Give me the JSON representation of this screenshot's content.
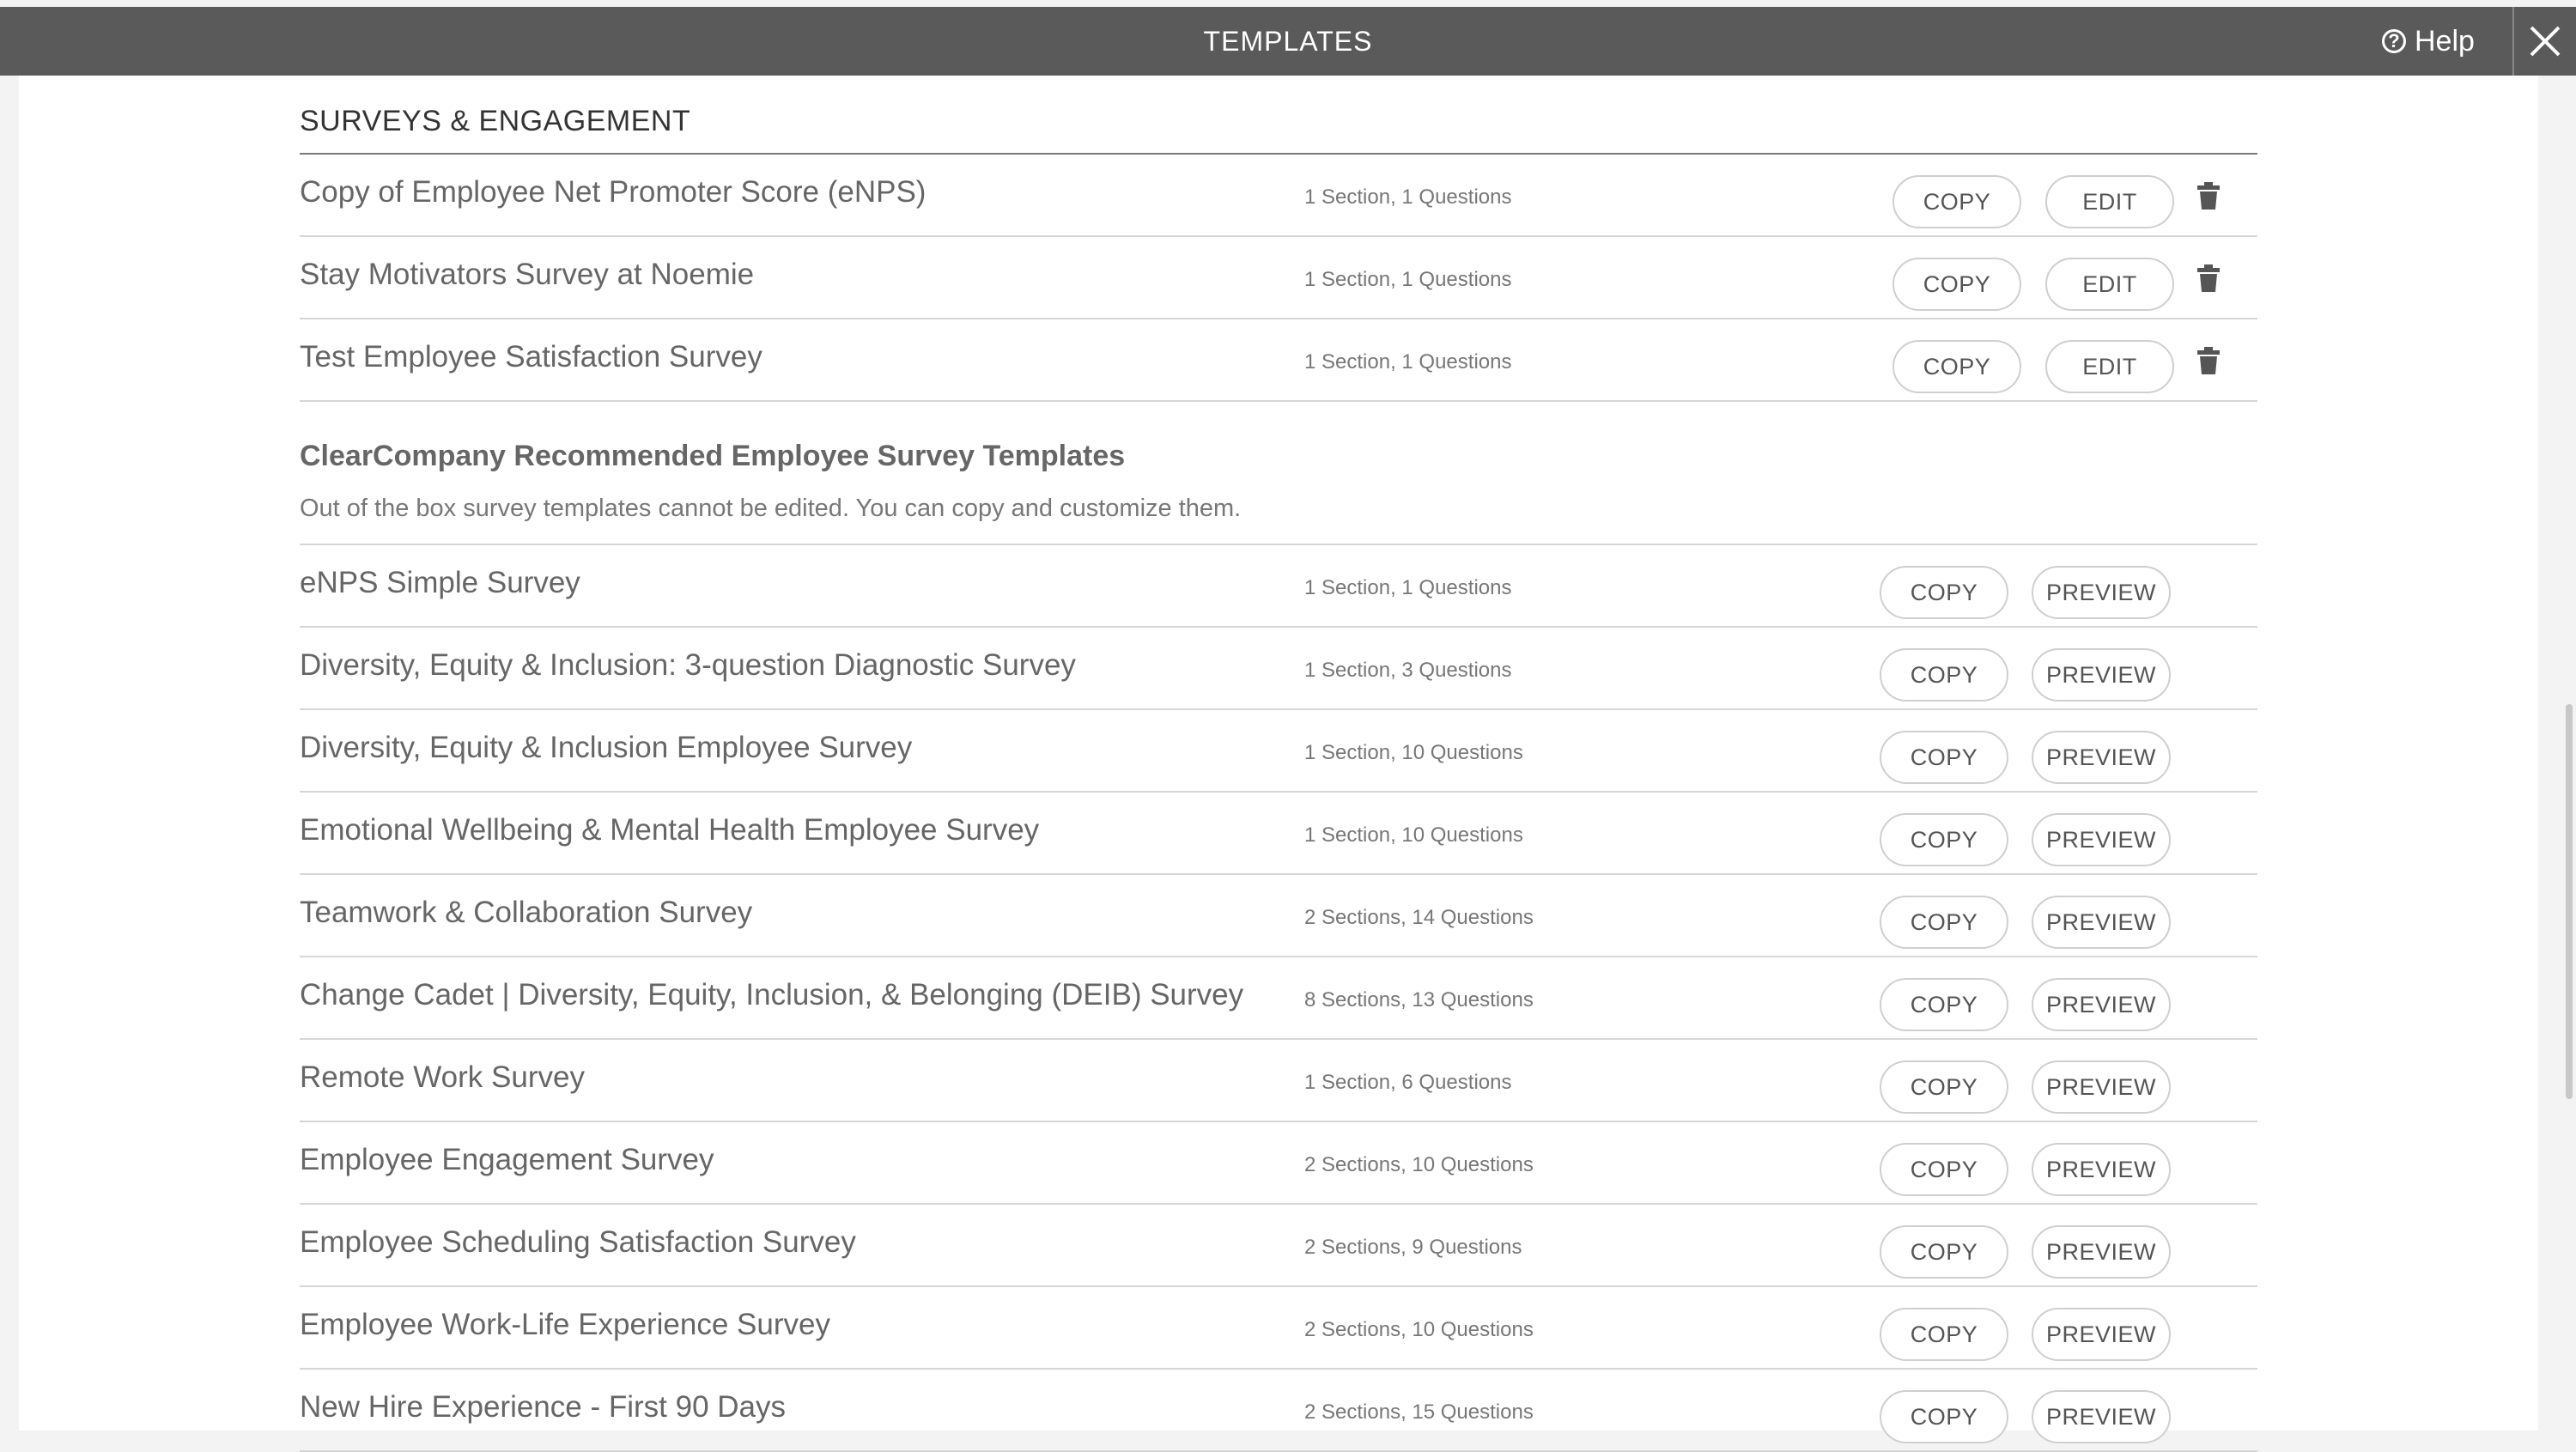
{
  "header": {
    "title": "TEMPLATES",
    "help_label": "Help"
  },
  "my_templates": {
    "title": "SURVEYS & ENGAGEMENT",
    "copy_label": "COPY",
    "edit_label": "EDIT",
    "rows": [
      {
        "name": "Copy of Employee Net Promoter Score (eNPS)",
        "meta": "1 Section, 1 Questions"
      },
      {
        "name": "Stay Motivators Survey at Noemie",
        "meta": "1 Section, 1 Questions"
      },
      {
        "name": "Test Employee Satisfaction Survey",
        "meta": "1 Section, 1 Questions"
      }
    ]
  },
  "recommended": {
    "title": "ClearCompany Recommended Employee Survey Templates",
    "subtitle": "Out of the box survey templates cannot be edited. You can copy and customize them.",
    "copy_label": "COPY",
    "preview_label": "PREVIEW",
    "rows": [
      {
        "name": "eNPS Simple Survey",
        "meta": "1 Section, 1 Questions"
      },
      {
        "name": "Diversity, Equity & Inclusion: 3-question Diagnostic Survey",
        "meta": "1 Section, 3 Questions"
      },
      {
        "name": "Diversity, Equity & Inclusion Employee Survey",
        "meta": "1 Section, 10 Questions"
      },
      {
        "name": "Emotional Wellbeing & Mental Health Employee Survey",
        "meta": "1 Section, 10 Questions"
      },
      {
        "name": "Teamwork & Collaboration Survey",
        "meta": "2 Sections, 14 Questions"
      },
      {
        "name": "Change Cadet | Diversity, Equity, Inclusion, & Belonging (DEIB) Survey",
        "meta": "8 Sections, 13 Questions"
      },
      {
        "name": "Remote Work Survey",
        "meta": "1 Section, 6 Questions"
      },
      {
        "name": "Employee Engagement Survey",
        "meta": "2 Sections, 10 Questions"
      },
      {
        "name": "Employee Scheduling Satisfaction Survey",
        "meta": "2 Sections, 9 Questions"
      },
      {
        "name": "Employee Work-Life Experience Survey",
        "meta": "2 Sections, 10 Questions"
      },
      {
        "name": "New Hire Experience - First 90 Days",
        "meta": "2 Sections, 15 Questions"
      }
    ]
  }
}
